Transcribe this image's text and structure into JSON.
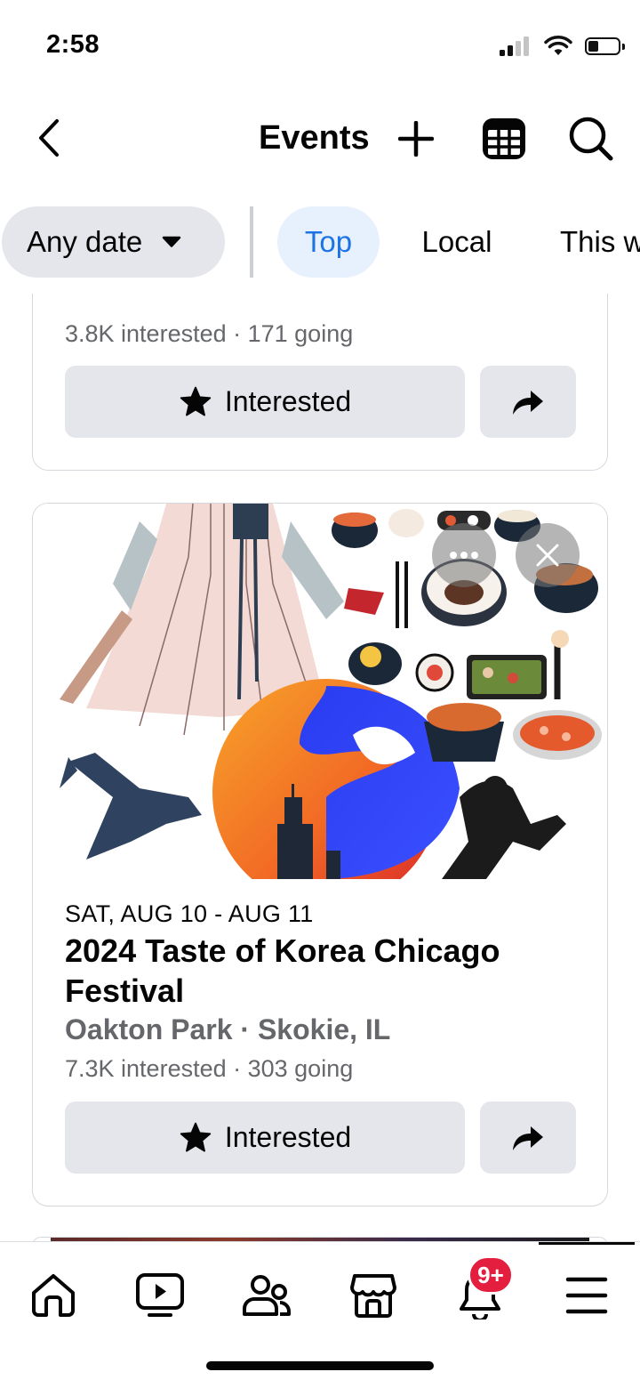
{
  "status_bar": {
    "time": "2:58",
    "battery_level": 0.35
  },
  "header": {
    "title": "Events"
  },
  "filters": {
    "date_chip": "Any date",
    "tabs": [
      "Top",
      "Local",
      "This w"
    ],
    "active_tab": "Top"
  },
  "previous_event": {
    "stats": "3.8K interested · 171 going",
    "interested_label": "Interested"
  },
  "event": {
    "date": "SAT, AUG 10 - AUG 11",
    "title": "2024 Taste of Korea Chicago Festival",
    "location": "Oakton Park · Skokie, IL",
    "stats": "7.3K interested · 303 going",
    "interested_label": "Interested"
  },
  "bottom_nav": {
    "items": [
      "home",
      "video",
      "friends",
      "marketplace",
      "notifications",
      "menu"
    ],
    "notifications_badge": "9+"
  },
  "colors": {
    "accent": "#1b74e4",
    "chip_bg": "#e4e6eb",
    "secondary_text": "#65676b",
    "badge": "#e41e3f"
  }
}
